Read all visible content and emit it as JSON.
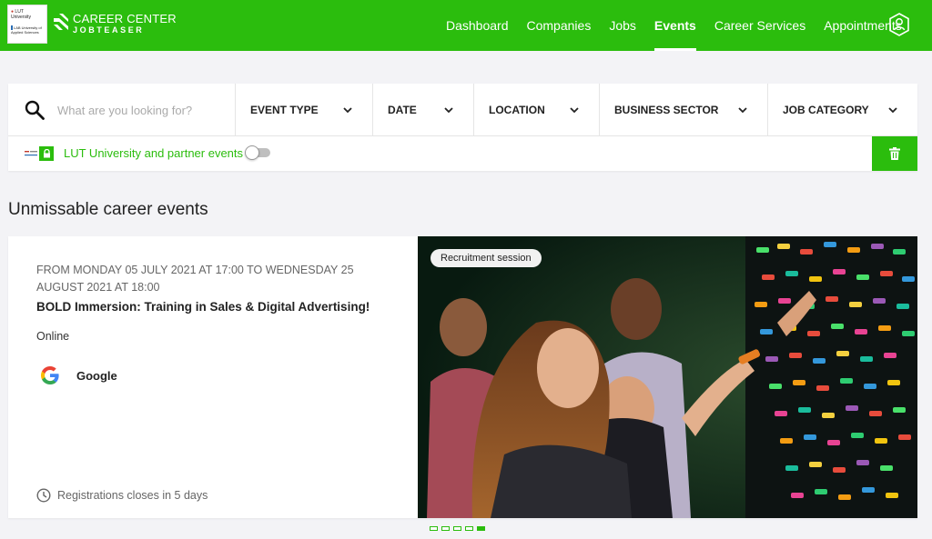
{
  "header": {
    "university_logo": {
      "line1": "LUT University",
      "line2": "LAB University of Applied Sciences"
    },
    "brand_line1": "CAREER CENTER",
    "brand_line2": "JOBTEASER",
    "nav": [
      {
        "label": "Dashboard",
        "active": false
      },
      {
        "label": "Companies",
        "active": false
      },
      {
        "label": "Jobs",
        "active": false
      },
      {
        "label": "Events",
        "active": true
      },
      {
        "label": "Career Services",
        "active": false
      },
      {
        "label": "Appointments",
        "active": false
      }
    ],
    "profile_icon": "user-shield-icon"
  },
  "filters": {
    "search_placeholder": "What are you looking for?",
    "search_value": "",
    "dropdowns": [
      {
        "label": "EVENT TYPE"
      },
      {
        "label": "DATE"
      },
      {
        "label": "LOCATION"
      },
      {
        "label": "BUSINESS SECTOR"
      },
      {
        "label": "JOB CATEGORY"
      }
    ],
    "partner_label": "LUT University and partner events",
    "partner_toggle_on": false,
    "clear_icon": "trash-icon"
  },
  "section": {
    "title": "Unmissable career events"
  },
  "event": {
    "date": "FROM MONDAY 05 JULY 2021 AT 17:00 TO WEDNESDAY 25 AUGUST 2021 AT 18:00",
    "title": "BOLD Immersion: Training in Sales & Digital Advertising!",
    "location": "Online",
    "company": "Google",
    "registration": "Registrations closes in 5 days",
    "tag": "Recruitment session"
  },
  "carousel": {
    "count": 5,
    "active_index": 4
  },
  "colors": {
    "brand_green": "#2bbd0d",
    "page_bg": "#f3f3f6"
  }
}
